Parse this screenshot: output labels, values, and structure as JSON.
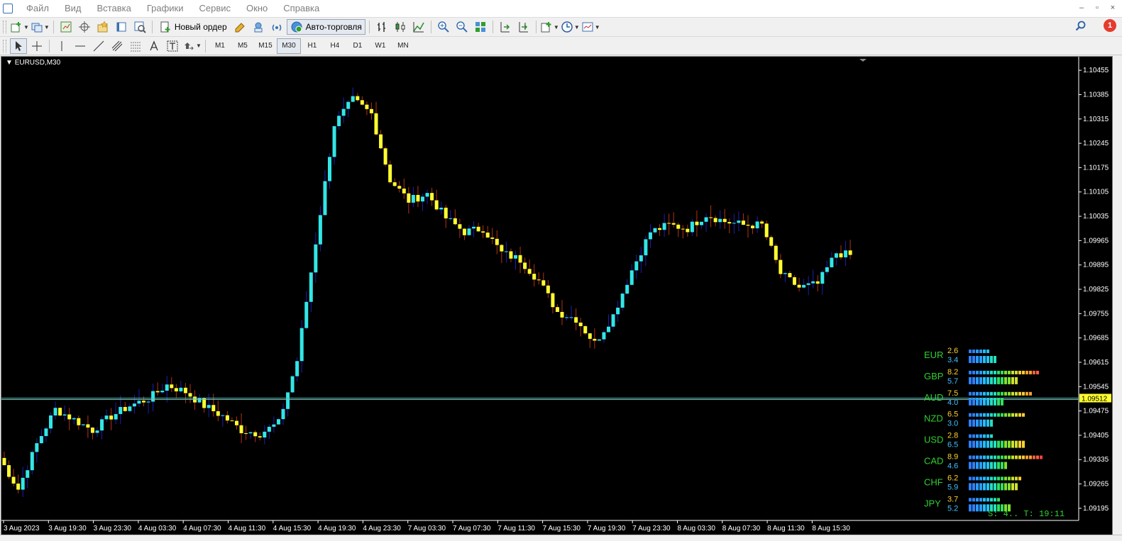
{
  "menu": [
    "Файл",
    "Вид",
    "Вставка",
    "Графики",
    "Сервис",
    "Окно",
    "Справка"
  ],
  "window_controls": [
    "–",
    "▫",
    "×"
  ],
  "toolbar": {
    "new_order_label": "Новый ордер",
    "autotrading_label": "Авто-торговля",
    "notification_count": "1"
  },
  "timeframes": [
    "M1",
    "M5",
    "M15",
    "M30",
    "H1",
    "H4",
    "D1",
    "W1",
    "MN"
  ],
  "active_timeframe": "M30",
  "chart": {
    "title": "EURUSD,M30",
    "current_price": "1.09512",
    "background": "#000000",
    "bull_color": "#32e6e6",
    "bear_color": "#ffff30",
    "bull_wick_color": "#1e1eb4",
    "bear_wick_color": "#b43214",
    "bid_line_color": "#a0b4a0"
  },
  "chart_data": {
    "type": "candlestick",
    "symbol": "EURUSD",
    "timeframe": "M30",
    "y_ticks": [
      "1.10455",
      "1.10385",
      "1.10315",
      "1.10245",
      "1.10175",
      "1.10105",
      "1.10035",
      "1.09965",
      "1.09895",
      "1.09825",
      "1.09755",
      "1.09685",
      "1.09615",
      "1.09545",
      "1.09475",
      "1.09405",
      "1.09335",
      "1.09265",
      "1.09195"
    ],
    "ylim": [
      1.0916,
      1.1049
    ],
    "x_ticks": [
      "3 Aug 2023",
      "3 Aug 19:30",
      "3 Aug 23:30",
      "4 Aug 03:30",
      "4 Aug 07:30",
      "4 Aug 11:30",
      "4 Aug 15:30",
      "4 Aug 19:30",
      "4 Aug 23:30",
      "7 Aug 03:30",
      "7 Aug 07:30",
      "7 Aug 11:30",
      "7 Aug 15:30",
      "7 Aug 19:30",
      "7 Aug 23:30",
      "8 Aug 03:30",
      "8 Aug 07:30",
      "8 Aug 11:30",
      "8 Aug 15:30"
    ],
    "close_path": [
      1.0934,
      1.0925,
      1.0938,
      1.0948,
      1.0945,
      1.0942,
      1.0946,
      1.0949,
      1.0951,
      1.0955,
      1.0953,
      1.0949,
      1.0946,
      1.0942,
      1.0941,
      1.0944,
      1.0962,
      1.0996,
      1.103,
      1.1037,
      1.1033,
      1.1014,
      1.1008,
      1.101,
      1.1003,
      1.0999,
      1.1,
      1.0993,
      1.0991,
      1.0985,
      1.0976,
      1.0974,
      1.0967,
      1.0975,
      1.0988,
      1.0999,
      1.1001,
      1.1,
      1.1004,
      1.1002,
      1.1001,
      1.1001,
      1.0987,
      1.0983,
      1.0984,
      1.0993,
      1.0992,
      1.0977,
      1.0965,
      1.0947,
      1.094,
      1.0951
    ],
    "bars_per_step": 4
  },
  "currency_strength": {
    "rows": [
      {
        "currency": "EUR",
        "v1": "2.6",
        "v2": "3.4",
        "b1": 2.6,
        "b2": 3.4
      },
      {
        "currency": "GBP",
        "v1": "8.2",
        "v2": "5.7",
        "b1": 8.2,
        "b2": 5.7
      },
      {
        "currency": "AUD",
        "v1": "7.5",
        "v2": "4.0",
        "b1": 7.5,
        "b2": 4.0
      },
      {
        "currency": "NZD",
        "v1": "6.5",
        "v2": "3.0",
        "b1": 6.5,
        "b2": 3.0
      },
      {
        "currency": "USD",
        "v1": "2.8",
        "v2": "6.5",
        "b1": 2.8,
        "b2": 6.5
      },
      {
        "currency": "CAD",
        "v1": "8.9",
        "v2": "4.6",
        "b1": 8.9,
        "b2": 4.6
      },
      {
        "currency": "CHF",
        "v1": "6.2",
        "v2": "5.9",
        "b1": 6.2,
        "b2": 5.9
      },
      {
        "currency": "JPY",
        "v1": "3.7",
        "v2": "5.2",
        "b1": 3.7,
        "b2": 5.2
      }
    ],
    "status": "S: 4.. T: 19:11"
  }
}
